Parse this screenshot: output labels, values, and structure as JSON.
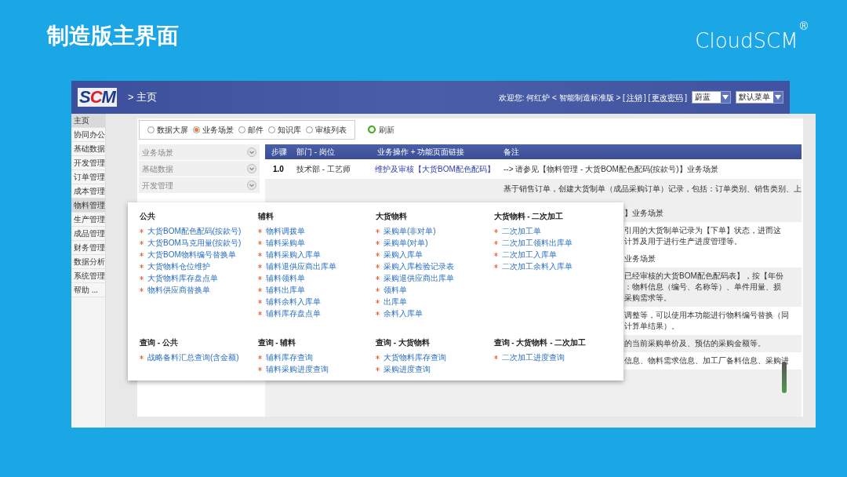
{
  "slide": {
    "title": "制造版主界面",
    "brand": "CloudSCM",
    "brand_mark": "®"
  },
  "header": {
    "logo": "SCM",
    "breadcrumb": "> 主页",
    "texts": [
      {
        "kind": "text",
        "text": "欢迎您: 何红炉 < 智能制造标准版 > ["
      },
      {
        "kind": "link",
        "text": "注销"
      },
      {
        "kind": "text",
        "text": "] ["
      },
      {
        "kind": "link",
        "text": "更改密码"
      },
      {
        "kind": "text",
        "text": "]"
      }
    ],
    "selects": [
      {
        "value": "蔚蓝"
      },
      {
        "value": "默认菜单"
      }
    ]
  },
  "sidebar": {
    "items": [
      {
        "label": "主页",
        "selected": true
      },
      {
        "label": "协同办公",
        "selected": false
      },
      {
        "label": "基础数据",
        "selected": false
      },
      {
        "label": "开发管理",
        "selected": false
      },
      {
        "label": "订单管理",
        "selected": false
      },
      {
        "label": "成本管理",
        "selected": false
      },
      {
        "label": "物料管理",
        "selected": true
      },
      {
        "label": "生产管理",
        "selected": false
      },
      {
        "label": "成品管理",
        "selected": false
      },
      {
        "label": "财务管理",
        "selected": false
      },
      {
        "label": "数据分析",
        "selected": false
      },
      {
        "label": "系统管理",
        "selected": false
      },
      {
        "label": "帮助 ...",
        "selected": false
      }
    ]
  },
  "view_options": [
    {
      "label": "数据大屏",
      "selected": false
    },
    {
      "label": "业务场景",
      "selected": true
    },
    {
      "label": "邮件",
      "selected": false
    },
    {
      "label": "知识库",
      "selected": false
    },
    {
      "label": "审核列表",
      "selected": false
    }
  ],
  "refresh_button": "刷新",
  "accordion": [
    "业务场景",
    "基础数据",
    "开发管理"
  ],
  "table": {
    "columns": [
      "步骤",
      "部门 - 岗位",
      "业务操作 + 功能页面链接",
      "备注"
    ],
    "rows": [
      {
        "step": "1.0",
        "dept": "技术部 - 工艺师",
        "action": "维护及审核【大货BOM配色配码】",
        "note": "--> 请参见【物料管理 - 大货BOM配色配码(按款号)】业务场景"
      },
      {
        "step": "",
        "dept": "",
        "action": "",
        "note": "基于销售订单，创建大货制单（成品采购订单）记录，包括：订单类别、销售类别、上"
      }
    ],
    "partial_notes": [
      {
        "lines": [
          "】业务场景"
        ],
        "shaded": true
      },
      {
        "lines": [
          "引用的大货制单记录为【下单】状态，进而这",
          "计算及用于进行生产进度管理等。"
        ],
        "shaded": false
      },
      {
        "lines": [
          "业务场景"
        ],
        "shaded": false
      },
      {
        "lines": [
          "已经审核的大货BOM配色配码表】，按【年份",
          "：物料信息（编号、名称等）、单件用量、损",
          "采购需求等。"
        ],
        "shaded": true
      },
      {
        "lines": [
          "调整等，可以使用本功能进行物料编号替换（同",
          "计算单结果）。"
        ],
        "shaded": false
      },
      {
        "lines": [
          "的当前采购单价及、预估的采购金额等。"
        ],
        "shaded": true
      },
      {
        "lines": [
          "信息、物料需求信息、加工厂备料信息、采购进"
        ],
        "shaded": false
      }
    ]
  },
  "menu": {
    "groups": [
      {
        "heading": "公共",
        "items": [
          "大货BOM配色配码(按款号)",
          "大货BOM马克用量(按款号)",
          "大货BOM物料编号替换单",
          "大货物料仓位维护",
          "大货物料库存盘点单",
          "物料供应商替换单"
        ]
      },
      {
        "heading": "辅料",
        "items": [
          "物料调拨单",
          "辅料采购单",
          "辅料采购入库单",
          "辅料退供应商出库单",
          "辅料领料单",
          "辅料出库单",
          "辅料余料入库单",
          "辅料库存盘点单"
        ]
      },
      {
        "heading": "大货物料",
        "items": [
          "采购单(非对单)",
          "采购单(对单)",
          "采购入库单",
          "采购入库检验记录表",
          "采购退供应商出库单",
          "领料单",
          "出库单",
          "余料入库单"
        ]
      },
      {
        "heading": "大货物料 - 二次加工",
        "items": [
          "二次加工单",
          "二次加工领料出库单",
          "二次加工入库单",
          "二次加工余料入库单"
        ]
      },
      {
        "heading": "查询 - 公共",
        "items": [
          "战略备料汇总查询(含金额)"
        ]
      },
      {
        "heading": "查询 - 辅料",
        "items": [
          "辅料库存查询",
          "辅料采购进度查询"
        ]
      },
      {
        "heading": "查询 - 大货物料",
        "items": [
          "大货物料库存查询",
          "采购进度查询"
        ]
      },
      {
        "heading": "查询 - 大货物料 - 二次加工",
        "items": [
          "二次加工进度查询"
        ]
      }
    ]
  }
}
